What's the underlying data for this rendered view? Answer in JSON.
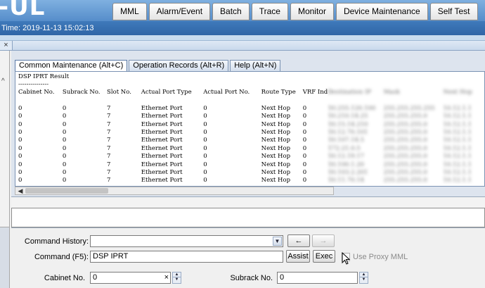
{
  "header": {
    "app_title": "-UL",
    "tabs": [
      "MML",
      "Alarm/Event",
      "Batch",
      "Trace",
      "Monitor",
      "Device Maintenance",
      "Self Test"
    ],
    "time_text": "Time: 2019-11-13 15:02:13",
    "close_symbol": "×"
  },
  "inner_tabs": [
    "Common Maintenance (Alt+C)",
    "Operation Records (Alt+R)",
    "Help (Alt+N)"
  ],
  "result": {
    "title": "DSP IPRT Result",
    "underline": "---------------",
    "columns": [
      "Cabinet No.",
      "Subrack No.",
      "Slot No.",
      "Actual Port Type",
      "Actual Port No.",
      "Route Type",
      "VRF Ind"
    ],
    "blurred_columns": [
      "Destination IP",
      "Mask",
      "Next Hop"
    ],
    "rows": [
      [
        "0",
        "0",
        "7",
        "Ethernet Port",
        "0",
        "Next Hop",
        "0"
      ],
      [
        "0",
        "0",
        "7",
        "Ethernet Port",
        "0",
        "Next Hop",
        "0"
      ],
      [
        "0",
        "0",
        "7",
        "Ethernet Port",
        "0",
        "Next Hop",
        "0"
      ],
      [
        "0",
        "0",
        "7",
        "Ethernet Port",
        "0",
        "Next Hop",
        "0"
      ],
      [
        "0",
        "0",
        "7",
        "Ethernet Port",
        "0",
        "Next Hop",
        "0"
      ],
      [
        "0",
        "0",
        "7",
        "Ethernet Port",
        "0",
        "Next Hop",
        "0"
      ],
      [
        "0",
        "0",
        "7",
        "Ethernet Port",
        "0",
        "Next Hop",
        "0"
      ],
      [
        "0",
        "0",
        "7",
        "Ethernet Port",
        "0",
        "Next Hop",
        "0"
      ],
      [
        "0",
        "0",
        "7",
        "Ethernet Port",
        "0",
        "Next Hop",
        "0"
      ],
      [
        "0",
        "0",
        "7",
        "Ethernet Port",
        "0",
        "Next Hop",
        "0"
      ]
    ],
    "blurred_rows": [
      [
        "10.255.120.100",
        "255.255.255.255",
        "10.12.1.1"
      ],
      [
        "10.210.14.25",
        "255.255.255.0",
        "10.12.1.1"
      ],
      [
        "10.15.14.210",
        "255.255.255.0",
        "10.12.1.1"
      ],
      [
        "10.12.70.101",
        "255.255.255.0",
        "10.12.1.1"
      ],
      [
        "10.107.14.5",
        "255.255.255.0",
        "10.12.1.1"
      ],
      [
        "172.21.0.5",
        "255.255.255.0",
        "10.12.1.1"
      ],
      [
        "10.12.19.17",
        "255.255.255.0",
        "10.12.1.1"
      ],
      [
        "10.100.1.20",
        "255.255.255.0",
        "10.12.1.1"
      ],
      [
        "10.103.2.201",
        "255.255.255.0",
        "10.12.1.1"
      ],
      [
        "10.11.70.14",
        "255.255.255.0",
        "10.12.1.1"
      ]
    ]
  },
  "form": {
    "command_history_label": "Command History:",
    "command_history_value": "",
    "back_arrow": "←",
    "forward_arrow": "→",
    "command_label": "Command (F5):",
    "command_value": "DSP IPRT",
    "assist_label": "Assist",
    "exec_label": "Exec",
    "use_proxy_label": "Use Proxy MML",
    "cabinet_label": "Cabinet No.",
    "cabinet_value": "0",
    "subrack_label": "Subrack No.",
    "subrack_value": "0",
    "clear_symbol": "×"
  },
  "icons": {
    "combo_arrow": "▼",
    "scroll_left": "◀",
    "panel_up": "^",
    "spin_up": "▲",
    "spin_down": "▼"
  }
}
